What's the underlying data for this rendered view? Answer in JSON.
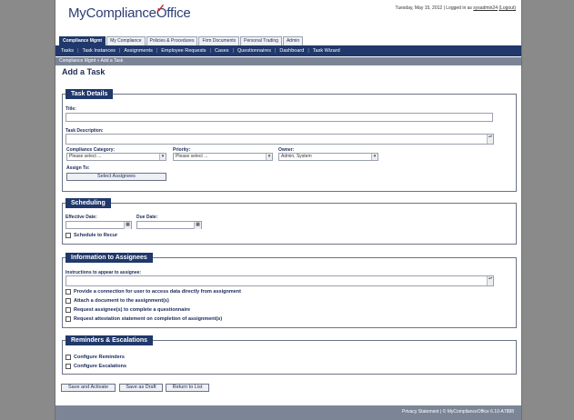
{
  "header": {
    "logo_text": "MyCompliance",
    "logo_office": "Office",
    "logo_check": "✓",
    "datetime": "Tuesday, May 15, 2012",
    "logged_in_prefix": "| Logged in as",
    "username": "sysadmin24",
    "logout": "(Logout)"
  },
  "tabs": [
    {
      "label": "Compliance Mgmt",
      "active": true
    },
    {
      "label": "My Compliance"
    },
    {
      "label": "Policies & Procedures"
    },
    {
      "label": "Firm Documents"
    },
    {
      "label": "Personal Trading"
    },
    {
      "label": "Admin"
    }
  ],
  "nav": [
    "Tasks",
    "Task Instances",
    "Assignments",
    "Employee Requests",
    "Cases",
    "Questionnaires",
    "Dashboard",
    "Task Wizard"
  ],
  "nav_separator": "|",
  "breadcrumb": "Compliance Mgmt »  Add a Task",
  "page_title": "Add a Task",
  "task_details": {
    "title": "Task Details",
    "title_label": "Title:",
    "description_label": "Task Description:",
    "category_label": "Compliance Category:",
    "category_value": "Please select ...",
    "priority_label": "Priority:",
    "priority_value": "Please select ...",
    "owner_label": "Owner:",
    "owner_value": "Admin, System",
    "assign_label": "Assign To:",
    "assign_button": "Select Assignees"
  },
  "scheduling": {
    "title": "Scheduling",
    "effective_label": "Effective Date:",
    "due_label": "Due Date:",
    "recur_label": "Schedule to Recur"
  },
  "info": {
    "title": "Information to Assignees",
    "instructions_label": "Instructions to appear to assignee:",
    "options": [
      "Provide a connection for user to access data directly from assignment",
      "Attach a document to the assignment(s)",
      "Request assignee(s) to complete a questionnaire",
      "Request attestation statement on completion of assignment(s)"
    ]
  },
  "reminders": {
    "title": "Reminders & Escalations",
    "options": [
      "Configure Reminders",
      "Configure Escalations"
    ]
  },
  "actions": {
    "save_activate": "Save and Activate",
    "save_draft": "Save as Draft",
    "return": "Return to List"
  },
  "footer": {
    "text": "Privacy Statement  |  © MyComplianceOffice 6.10-A7888"
  },
  "glyphs": {
    "dropdown": "▾",
    "calendar": "▦",
    "scroll": "▴▾"
  }
}
